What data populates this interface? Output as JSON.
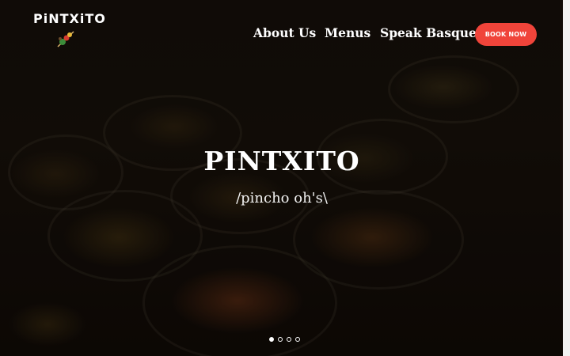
{
  "logo": {
    "text": "PiNTXiTO",
    "icon": "skewer-pintxo-icon"
  },
  "nav": {
    "items": [
      {
        "label": "About Us"
      },
      {
        "label": "Menus"
      },
      {
        "label": "Speak Basque"
      }
    ],
    "book_label": "BOOK NOW"
  },
  "hero": {
    "title": "PINTXITO",
    "subtitle": "/pincho oh's\\"
  },
  "slider": {
    "count": 4,
    "active_index": 0
  },
  "colors": {
    "accent": "#f0443a",
    "text": "#ffffff"
  }
}
